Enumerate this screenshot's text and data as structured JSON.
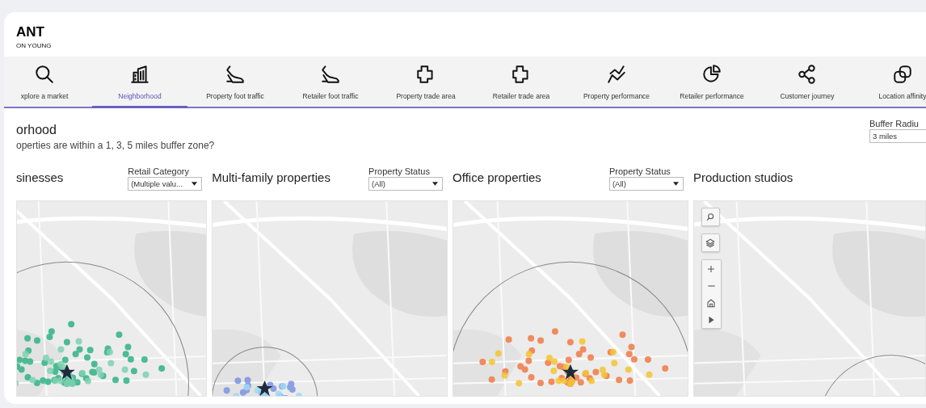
{
  "brand": {
    "logo": "ANT",
    "subtitle": "ON YOUNG"
  },
  "tabs": [
    {
      "kind": "search",
      "label": "xplore a market",
      "selected": false
    },
    {
      "kind": "buildings",
      "label": "Neighborhood",
      "selected": true
    },
    {
      "kind": "shoe",
      "label": "Property foot traffic",
      "selected": false
    },
    {
      "kind": "shoe",
      "label": "Retailer foot traffic",
      "selected": false
    },
    {
      "kind": "area",
      "label": "Property trade area",
      "selected": false
    },
    {
      "kind": "area",
      "label": "Retailer trade area",
      "selected": false
    },
    {
      "kind": "trend",
      "label": "Property performance",
      "selected": false
    },
    {
      "kind": "pie",
      "label": "Retailer performance",
      "selected": false
    },
    {
      "kind": "share",
      "label": "Customer journey",
      "selected": false
    },
    {
      "kind": "link",
      "label": "Location affinity",
      "selected": false
    }
  ],
  "page": {
    "title": "orhood",
    "subtitle": "operties are within a 1, 3, 5 miles buffer zone?",
    "buffer": {
      "label": "Buffer Radiu",
      "value": "3 miles"
    }
  },
  "panels": [
    {
      "title": "sinesses",
      "filter": {
        "label": "Retail Category",
        "value": "(Multiple valu..."
      }
    },
    {
      "title": "Multi-family properties",
      "filter": {
        "label": "Property Status",
        "value": "(All)"
      }
    },
    {
      "title": "Office properties",
      "filter": {
        "label": "Property Status",
        "value": "(All)"
      }
    },
    {
      "title": "Production studios",
      "map": {
        "kind": "picture",
        "controls": [
          {
            "kind": "search"
          },
          {
            "kind": "layers"
          },
          {
            "kind": "zoom_in"
          },
          {
            "kind": "zoom_out"
          },
          {
            "kind": "home"
          },
          {
            "kind": "play"
          }
        ]
      }
    }
  ]
}
